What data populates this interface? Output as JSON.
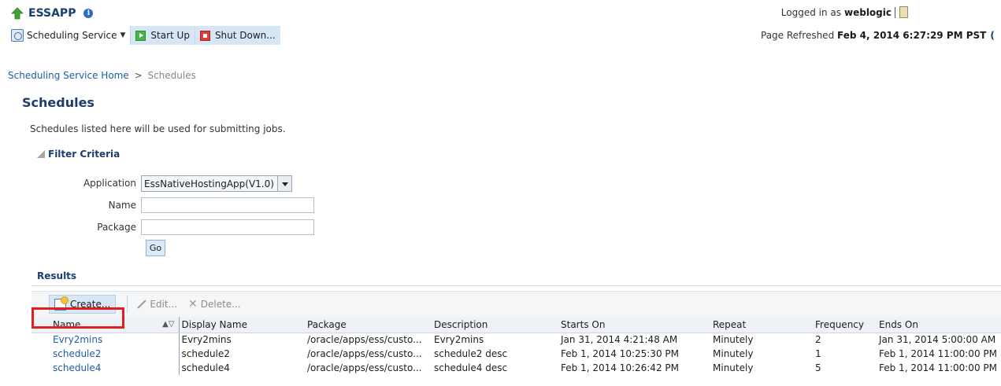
{
  "header": {
    "app_name": "ESSAPP",
    "info_icon": "i",
    "service_menu": "Scheduling Service",
    "start_up": "Start Up",
    "shut_down": "Shut Down...",
    "logged_in_prefix": "Logged in as",
    "username": "weblogic",
    "refreshed_prefix": "Page Refreshed",
    "refreshed_time": "Feb 4, 2014 6:27:29 PM PST",
    "refreshed_trailing": "("
  },
  "breadcrumb": {
    "home": "Scheduling Service Home",
    "separator": ">",
    "current": "Schedules"
  },
  "page": {
    "title": "Schedules",
    "description": "Schedules listed here will be used for submitting jobs."
  },
  "filter": {
    "title": "Filter Criteria",
    "application_label": "Application",
    "application_value": "EssNativeHostingApp(V1.0)",
    "name_label": "Name",
    "name_value": "",
    "package_label": "Package",
    "package_value": "",
    "go_label": "Go"
  },
  "results": {
    "title": "Results",
    "create_label": "Create...",
    "edit_label": "Edit...",
    "delete_label": "Delete...",
    "columns": [
      "Name",
      "Display Name",
      "Package",
      "Description",
      "Starts On",
      "Repeat",
      "Frequency",
      "Ends On"
    ],
    "rows": [
      [
        "Evry2mins",
        "Evry2mins",
        "/oracle/apps/ess/custo...",
        "Evry2mins",
        "Jan 31, 2014 4:21:48 AM",
        "Minutely",
        "2",
        "Jan 31, 2014 5:00:00 AM"
      ],
      [
        "schedule2",
        "schedule2",
        "/oracle/apps/ess/custo...",
        "schedule2 desc",
        "Feb 1, 2014 10:25:30 PM",
        "Minutely",
        "1",
        "Feb 1, 2014 11:00:00 PM"
      ],
      [
        "schedule4",
        "schedule4",
        "/oracle/apps/ess/custo...",
        "schedule4 desc",
        "Feb 1, 2014 10:26:42 PM",
        "Minutely",
        "5",
        "Feb 1, 2014 11:00:00 PM"
      ]
    ]
  },
  "colors": {
    "accent": "#1a3e6e",
    "link": "#1f5ca8",
    "highlight": "#e01f1f"
  }
}
